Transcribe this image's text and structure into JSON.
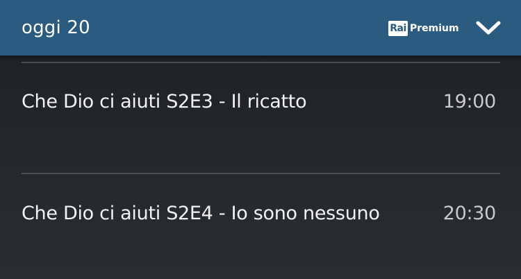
{
  "header": {
    "title": "oggi 20",
    "channel_logo_box": "Rai",
    "channel_logo_text": "Premium",
    "expand_icon": "chevron-down-icon"
  },
  "schedule": [
    {
      "title": "Che Dio ci aiuti S2E3 - Il ricatto",
      "time": "19:00"
    },
    {
      "title": "Che Dio ci aiuti S2E4 - Io sono nessuno",
      "time": "20:30"
    }
  ],
  "colors": {
    "header_bg": "#2b5c7f",
    "background": "#202327",
    "text": "#f3f3f3",
    "time_text": "#c9c9c9",
    "divider": "#4a4d52"
  }
}
